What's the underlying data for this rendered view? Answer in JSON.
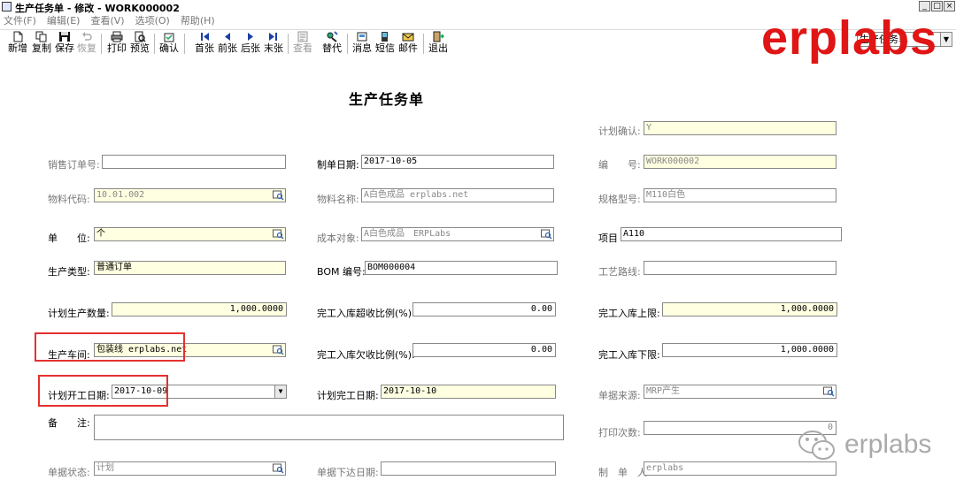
{
  "window": {
    "title": "生产任务单 - 修改 - WORK000002",
    "controls": [
      "_",
      "□",
      "×"
    ]
  },
  "menu": [
    "文件(F)",
    "编辑(E)",
    "查看(V)",
    "选项(O)",
    "帮助(H)"
  ],
  "toolbar": {
    "new": "新增",
    "copy": "复制",
    "save": "保存",
    "restore": "恢复",
    "print": "打印",
    "preview": "预览",
    "confirm": "确认",
    "first": "首张",
    "prev": "前张",
    "next": "后张",
    "last": "末张",
    "view": "查看",
    "replace": "替代",
    "message": "消息",
    "sms": "短信",
    "email": "邮件",
    "exit": "退出",
    "combo_value": "生产任务单"
  },
  "watermark": {
    "top": "erplabs",
    "bottom": "erplabs"
  },
  "form": {
    "title": "生产任务单",
    "plan_confirm": {
      "label": "计划确认:",
      "value": "Y"
    },
    "sales_order": {
      "label": "销售订单号:",
      "value": ""
    },
    "make_date": {
      "label": "制单日期:",
      "value": "2017-10-05"
    },
    "number": {
      "label": "编　　号:",
      "value": "WORK000002"
    },
    "material_code": {
      "label": "物料代码:",
      "value": "10.01.002"
    },
    "material_name": {
      "label": "物料名称:",
      "value": "A白色成品 erplabs.net"
    },
    "spec": {
      "label": "规格型号:",
      "value": "M110白色"
    },
    "unit": {
      "label": "单　　位:",
      "value": "个"
    },
    "cost_object": {
      "label": "成本对象:",
      "value": "A白色成品　ERPLabs"
    },
    "project": {
      "label": "项目",
      "value": "A110"
    },
    "prod_type": {
      "label": "生产类型:",
      "value": "普通订单"
    },
    "bom": {
      "label": "BOM 编号:",
      "value": "BOM000004"
    },
    "route": {
      "label": "工艺路线:",
      "value": ""
    },
    "plan_qty": {
      "label": "计划生产数量:",
      "value": "1,000.0000"
    },
    "over_ratio": {
      "label": "完工入库超收比例(%):",
      "value": "0.00"
    },
    "upper_limit": {
      "label": "完工入库上限:",
      "value": "1,000.0000"
    },
    "workshop": {
      "label": "生产车间:",
      "value": "包装线 erplabs.net"
    },
    "under_ratio": {
      "label": "完工入库欠收比例(%):",
      "value": "0.00"
    },
    "lower_limit": {
      "label": "完工入库下限:",
      "value": "1,000.0000"
    },
    "start_date": {
      "label": "计划开工日期:",
      "value": "2017-10-09"
    },
    "finish_date": {
      "label": "计划完工日期:",
      "value": "2017-10-10"
    },
    "source": {
      "label": "单据来源:",
      "value": "MRP产生"
    },
    "remark": {
      "label": "备　　注:",
      "value": ""
    },
    "print_count": {
      "label": "打印次数:",
      "value": "0"
    },
    "status": {
      "label": "单据状态:",
      "value": "计划"
    },
    "issue_date": {
      "label": "单据下达日期:",
      "value": ""
    },
    "maker": {
      "label": "制　单　人:",
      "value": "erplabs"
    }
  },
  "colors": {
    "highlight": "#e53030",
    "field_yellow": "#ffffe1",
    "watermark_red": "#e01515"
  }
}
